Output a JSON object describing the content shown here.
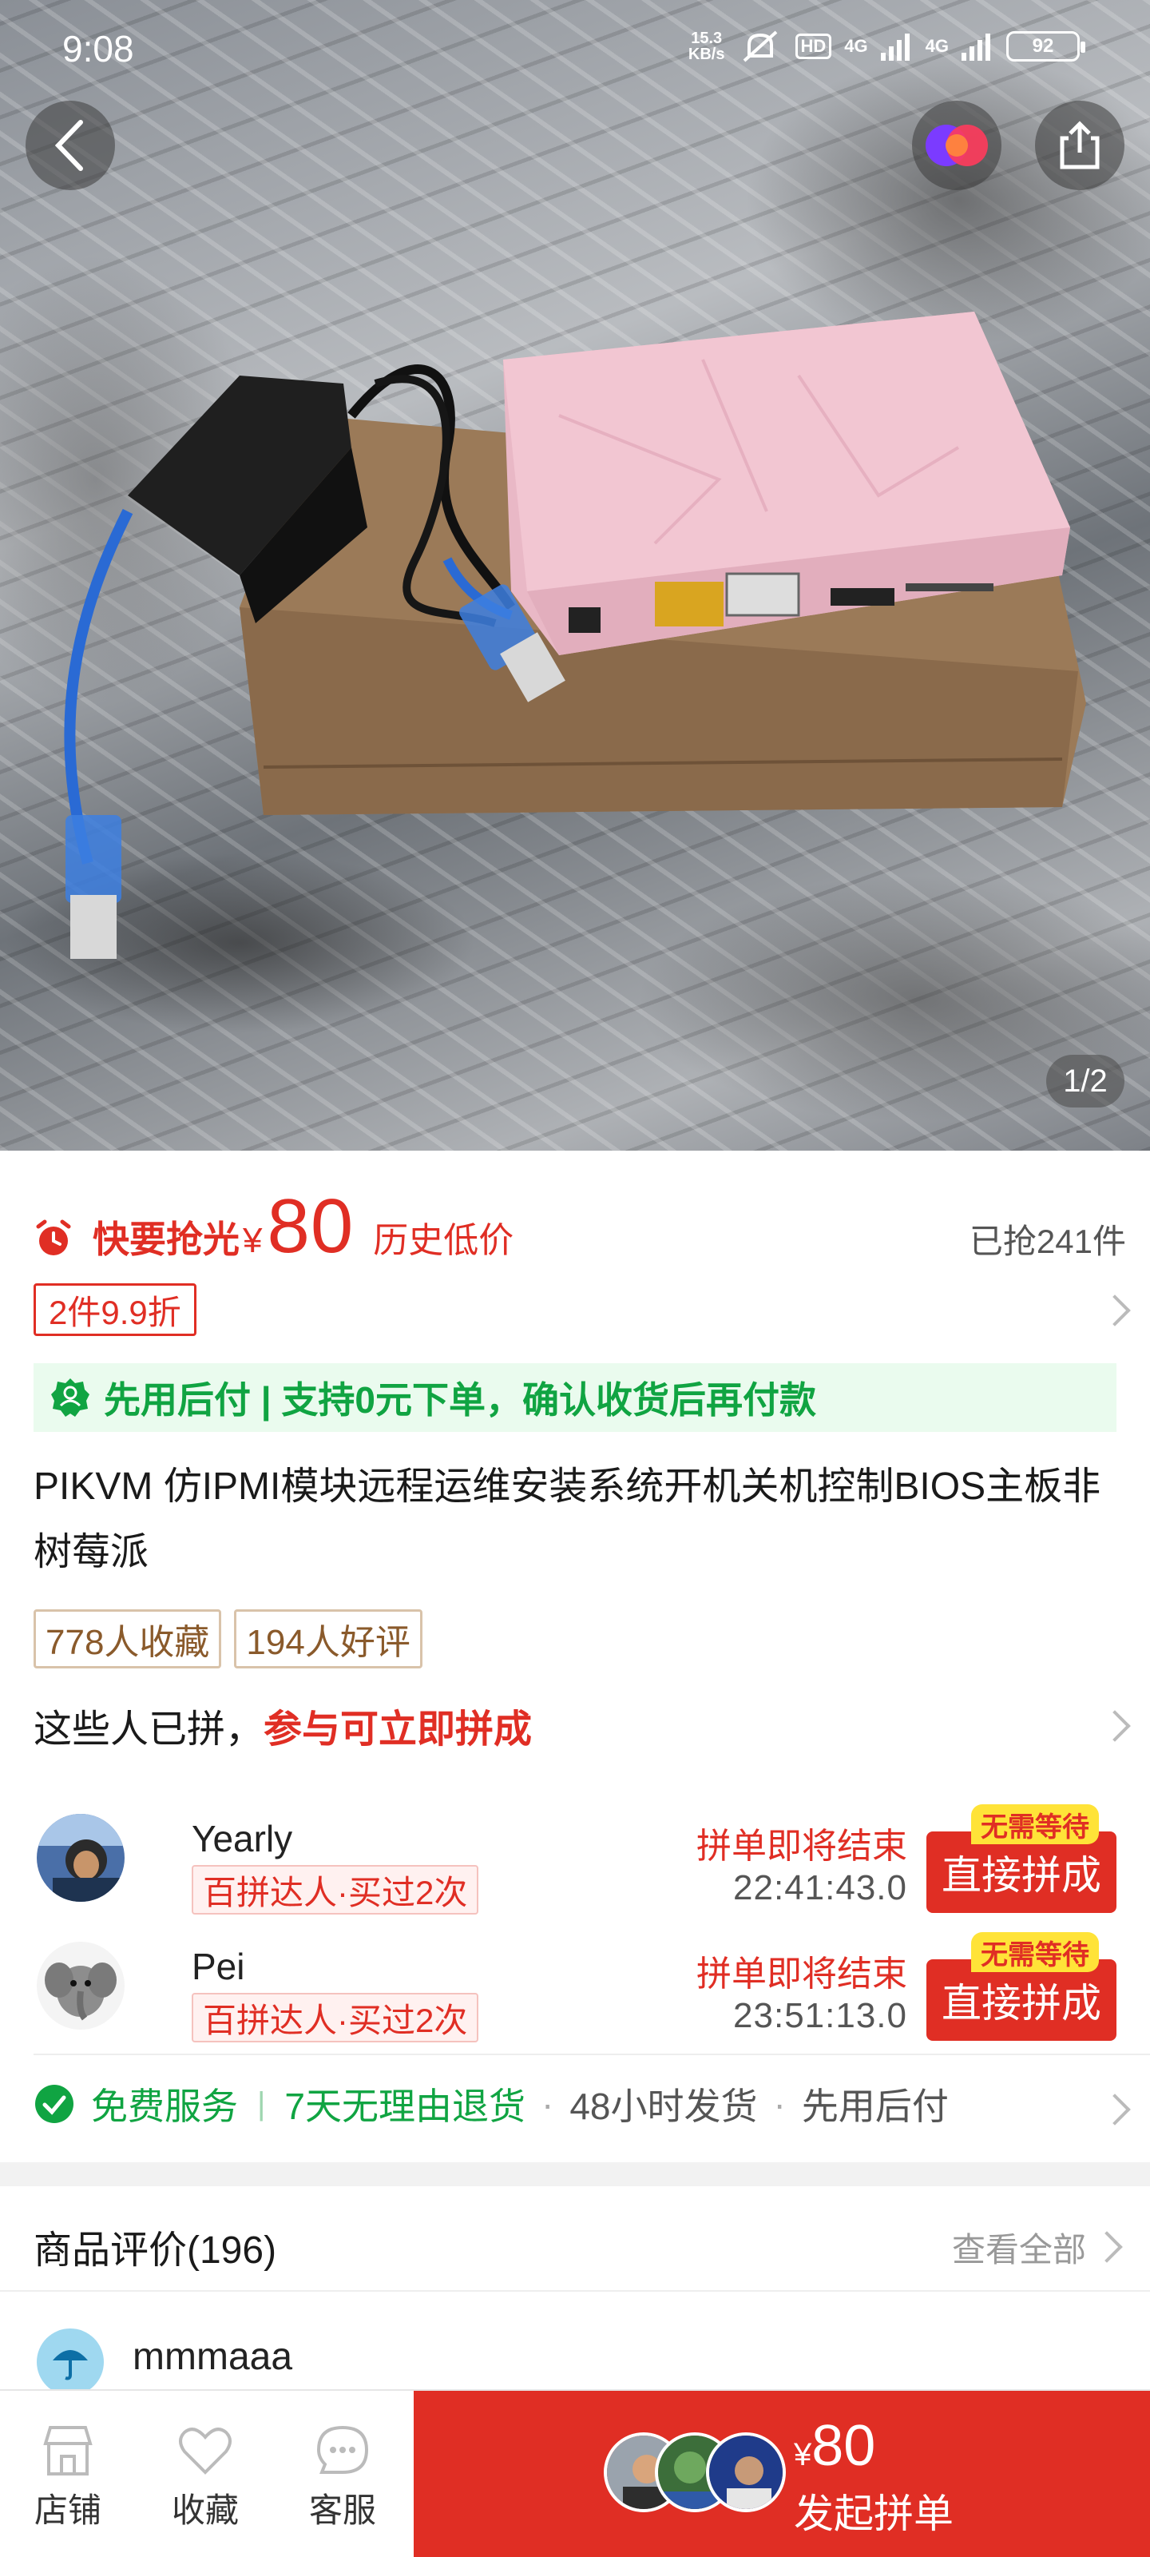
{
  "status_bar": {
    "time": "9:08",
    "net_speed_value": "15.3",
    "net_speed_unit": "KB/s",
    "hd_label": "HD",
    "signal_1": "4G",
    "signal_2": "4G",
    "battery": "92"
  },
  "hero": {
    "back_icon": "chevron-left-icon",
    "app_icon": "pdd-logo-icon",
    "share_icon": "share-icon",
    "counter": "1/2"
  },
  "price": {
    "hot_label": "快要抢光",
    "currency": "¥",
    "amount": "80",
    "history_low": "历史低价",
    "sold": "已抢241件"
  },
  "discount": {
    "label": "2件9.9折"
  },
  "pay_later": {
    "text": "先用后付 | 支持0元下单，确认收货后再付款"
  },
  "product": {
    "title": "PIKVM 仿IPMI模块远程运维安装系统开机关机控制BIOS主板非树莓派"
  },
  "tags": [
    "778人收藏",
    "194人好评"
  ],
  "group": {
    "prefix": "这些人已拼，",
    "highlight": "参与可立即拼成",
    "buyers": [
      {
        "name": "Yearly",
        "badge": "百拼达人·买过2次",
        "ending": "拼单即将结束",
        "timer": "22:41:43.0",
        "button": "直接拼成",
        "tip": "无需等待"
      },
      {
        "name": "Pei",
        "badge": "百拼达人·买过2次",
        "ending": "拼单即将结束",
        "timer": "23:51:13.0",
        "button": "直接拼成",
        "tip": "无需等待"
      }
    ]
  },
  "services": {
    "free": "免费服务",
    "return": "7天无理由退货",
    "ship": "48小时发货",
    "pay_later": "先用后付"
  },
  "reviews": {
    "title": "商品评价(196)",
    "view_all": "查看全部",
    "first_reviewer": "mmmaaa"
  },
  "bottom_nav": {
    "store": "店铺",
    "favorite": "收藏",
    "service": "客服"
  },
  "buy": {
    "currency": "¥",
    "price": "80",
    "label": "发起拼单"
  },
  "colors": {
    "accent_red": "#e02e24",
    "accent_green": "#10a442",
    "tag_brown": "#8a5a2b",
    "nowait_yellow": "#ffe338"
  }
}
